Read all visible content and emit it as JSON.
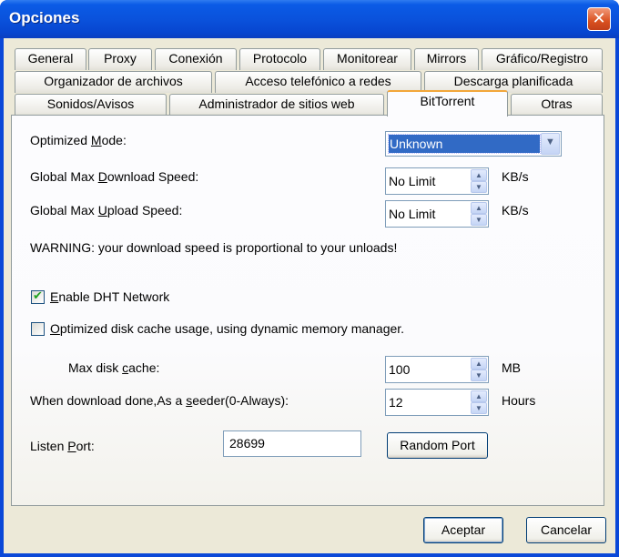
{
  "window": {
    "title": "Opciones",
    "close_glyph": "✕"
  },
  "tabs": {
    "row1": [
      "General",
      "Proxy",
      "Conexión",
      "Protocolo",
      "Monitorear",
      "Mirrors",
      "Gráfico/Registro"
    ],
    "row2": [
      "Organizador de archivos",
      "Acceso telefónico a redes",
      "Descarga planificada"
    ],
    "row3": [
      "Sonidos/Avisos",
      "Administrador de sitios web",
      "BitTorrent",
      "Otras"
    ],
    "active": "BitTorrent"
  },
  "bittorrent": {
    "optimized_mode": {
      "label_pre": "Optimized ",
      "label_key": "M",
      "label_post": "ode:",
      "value": "Unknown"
    },
    "max_download": {
      "label_pre": "Global Max ",
      "label_key": "D",
      "label_post": "ownload Speed:",
      "value": "No Limit",
      "unit": "KB/s"
    },
    "max_upload": {
      "label_pre": "Global Max ",
      "label_key": "U",
      "label_post": "pload Speed:",
      "value": "No Limit",
      "unit": "KB/s"
    },
    "warning": "WARNING: your download speed is proportional to your unloads!",
    "dht": {
      "label_key": "E",
      "label_post": "nable DHT Network",
      "checked": true
    },
    "disk_cache_opt": {
      "label_key": "O",
      "label_post": "ptimized disk cache usage, using dynamic memory manager.",
      "checked": false
    },
    "max_disk_cache": {
      "label_pre": "Max disk ",
      "label_key": "c",
      "label_post": "ache:",
      "value": "100",
      "unit": "MB"
    },
    "seeder": {
      "label_pre": "When download done,As a ",
      "label_key": "s",
      "label_post": "eeder(0-Always):",
      "value": "12",
      "unit": "Hours"
    },
    "listen_port": {
      "label_pre": "Listen ",
      "label_key": "P",
      "label_post": "ort:",
      "value": "28699"
    },
    "random_port_button": "Random Port"
  },
  "footer": {
    "ok": "Aceptar",
    "cancel": "Cancelar"
  },
  "icons": {
    "check": "✔",
    "up": "▲",
    "down": "▼",
    "dropdown": "▼"
  }
}
